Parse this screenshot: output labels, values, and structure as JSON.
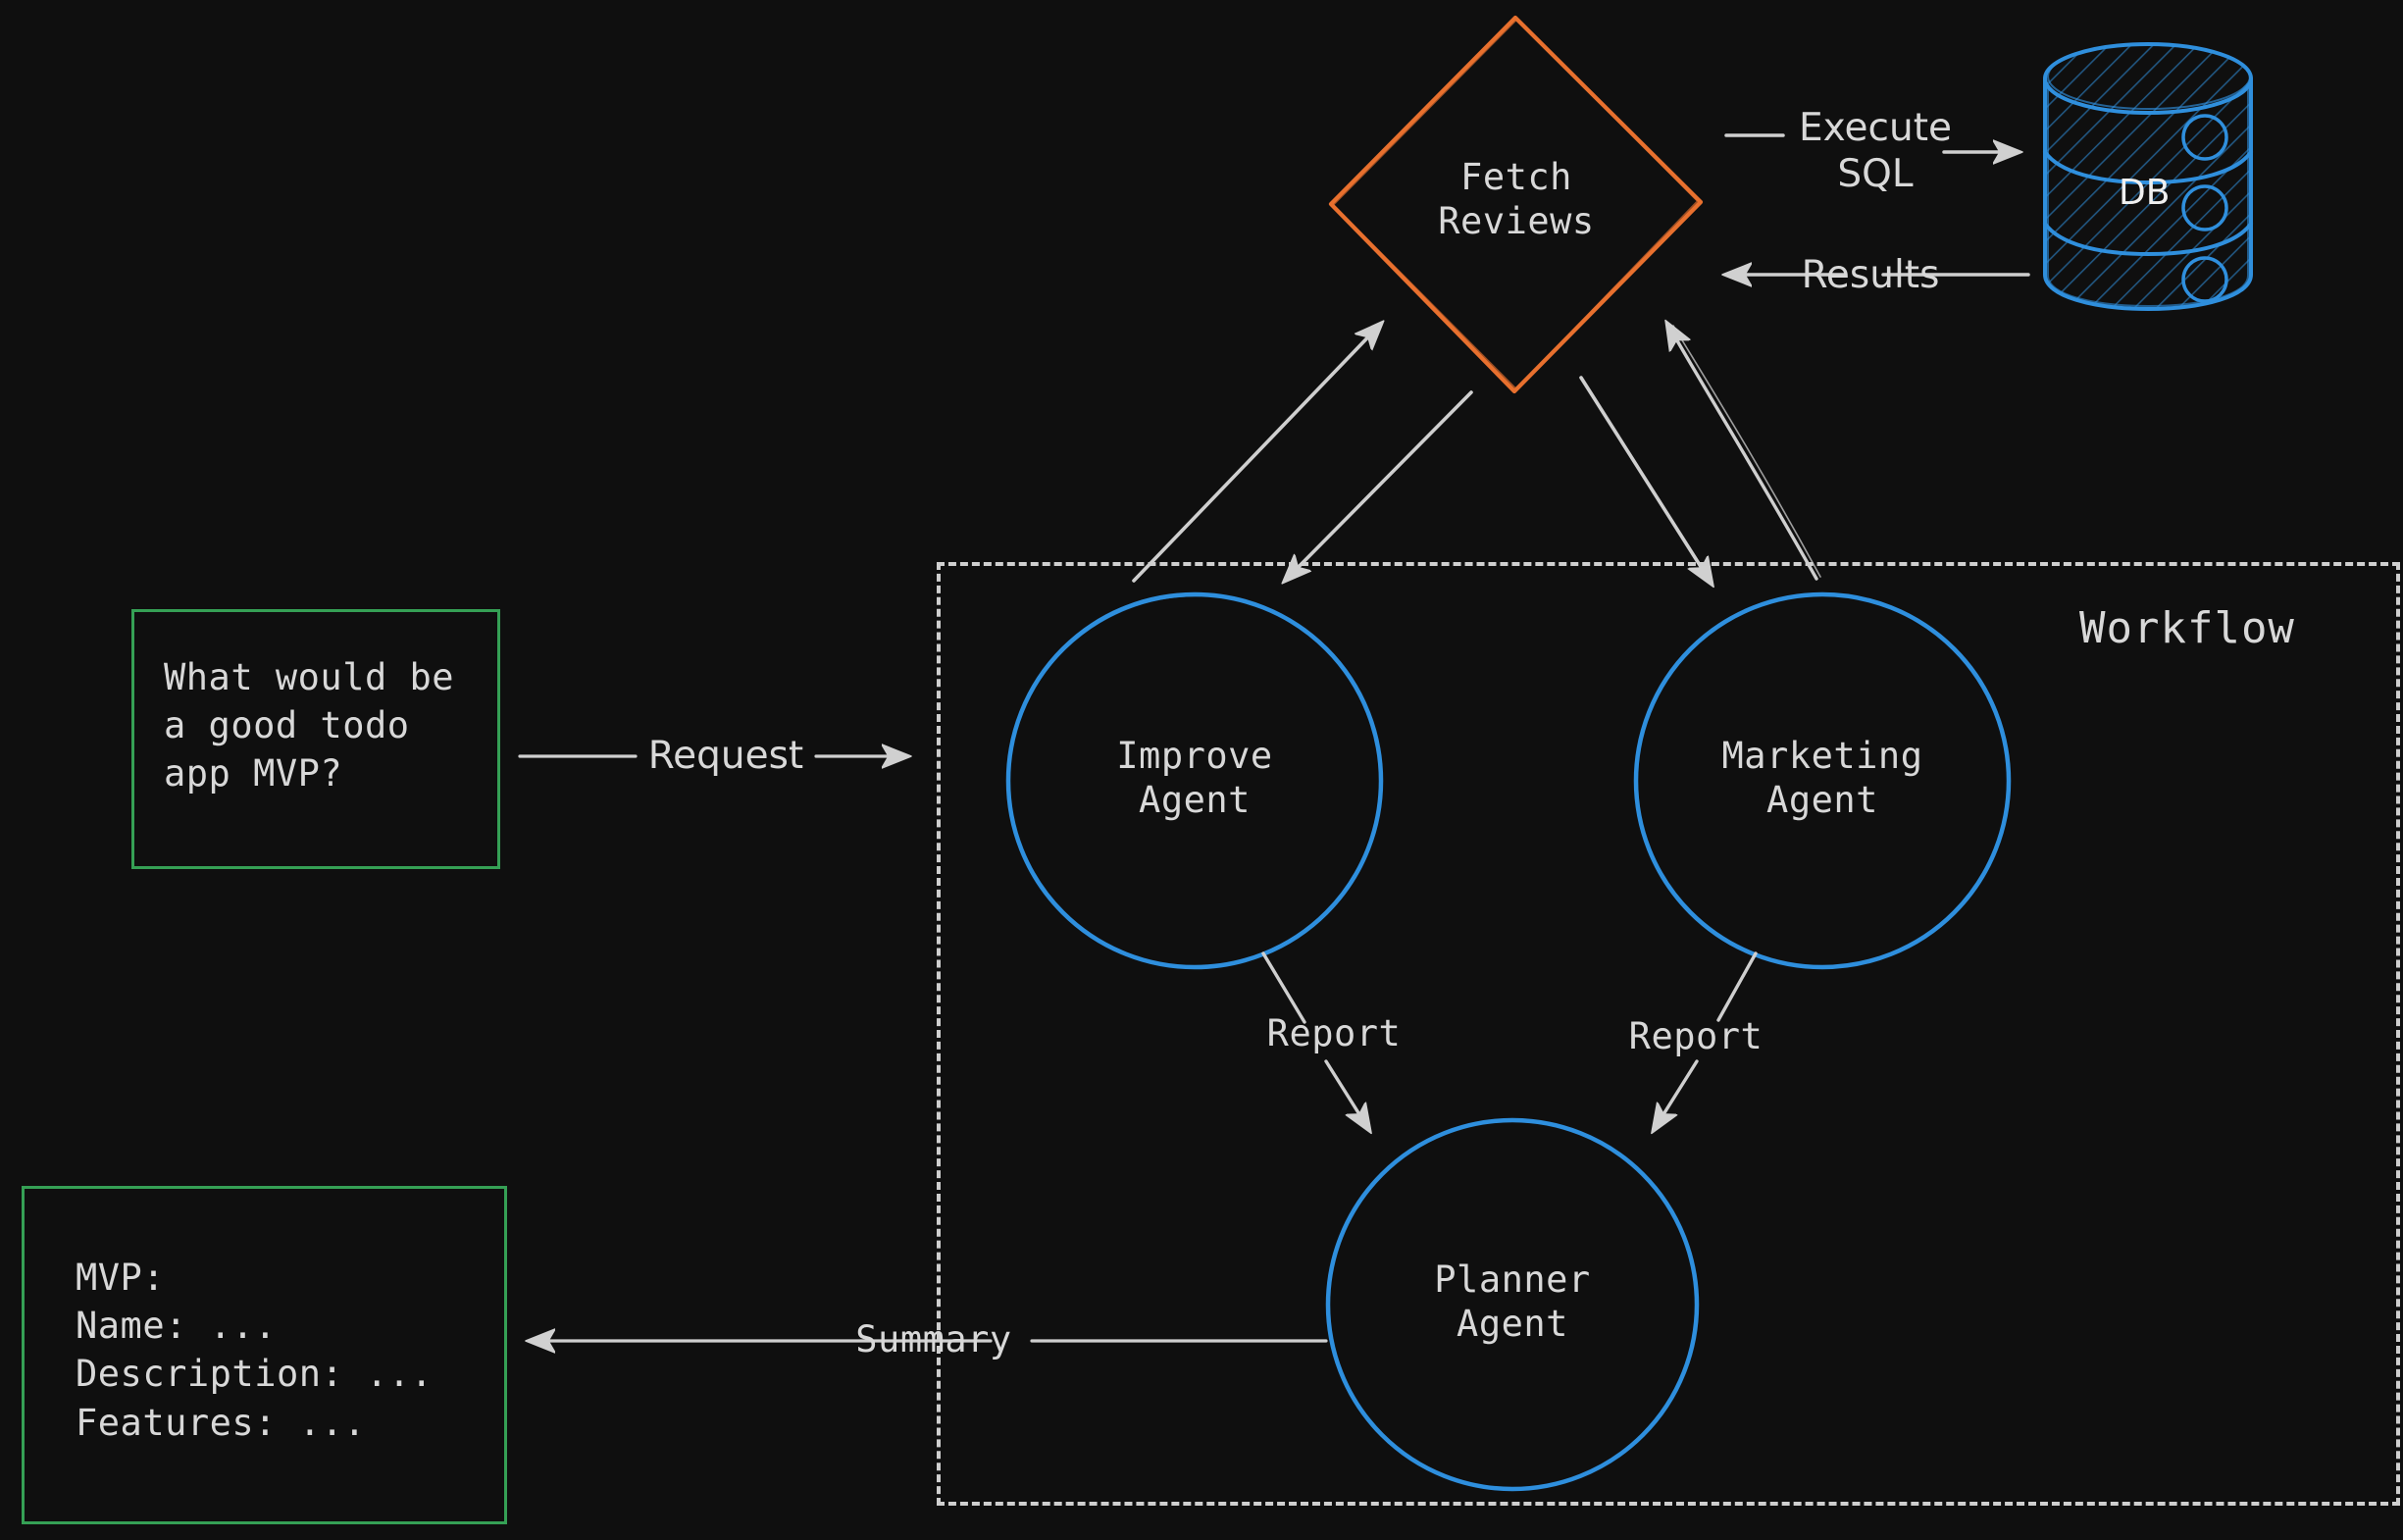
{
  "diagram": {
    "title": "Multi-agent workflow with review fetching",
    "background_color": "#0f0f0f",
    "colors": {
      "orange": "#e8702e",
      "blue": "#2f8fdd",
      "green": "#35a055",
      "stroke": "#cfcfcf",
      "text": "#d8d8d8"
    }
  },
  "workflow": {
    "title": "Workflow"
  },
  "nodes": {
    "fetch_reviews": {
      "label": "Fetch\nReviews",
      "shape": "diamond",
      "color": "#e8702e"
    },
    "database": {
      "label": "DB",
      "shape": "cylinder",
      "color": "#2f8fdd"
    },
    "improve_agent": {
      "label": "Improve\nAgent",
      "shape": "circle",
      "color": "#2f8fdd"
    },
    "marketing_agent": {
      "label": "Marketing\nAgent",
      "shape": "circle",
      "color": "#2f8fdd"
    },
    "planner_agent": {
      "label": "Planner\nAgent",
      "shape": "circle",
      "color": "#2f8fdd"
    },
    "input_box": {
      "text": "What would be\na good todo\napp MVP?",
      "shape": "rect",
      "color": "#35a055"
    },
    "output_box": {
      "text": "MVP:\nName: ...\nDescription: ...\nFeatures: ...",
      "shape": "rect",
      "color": "#35a055"
    }
  },
  "edges": [
    {
      "id": "execute-sql",
      "label": "Execute\nSQL",
      "from": "fetch_reviews",
      "to": "database"
    },
    {
      "id": "results",
      "label": "Results",
      "from": "database",
      "to": "fetch_reviews"
    },
    {
      "id": "request",
      "label": "Request",
      "from": "input_box",
      "to": "improve_agent"
    },
    {
      "id": "improve-to-fetch",
      "label": "",
      "from": "improve_agent",
      "to": "fetch_reviews"
    },
    {
      "id": "fetch-to-improve",
      "label": "",
      "from": "fetch_reviews",
      "to": "improve_agent"
    },
    {
      "id": "marketing-to-fetch",
      "label": "",
      "from": "marketing_agent",
      "to": "fetch_reviews"
    },
    {
      "id": "fetch-to-marketing",
      "label": "",
      "from": "fetch_reviews",
      "to": "marketing_agent"
    },
    {
      "id": "improve-report",
      "label": "Report",
      "from": "improve_agent",
      "to": "planner_agent"
    },
    {
      "id": "marketing-report",
      "label": "Report",
      "from": "marketing_agent",
      "to": "planner_agent"
    },
    {
      "id": "summary",
      "label": "Summary",
      "from": "planner_agent",
      "to": "output_box"
    }
  ]
}
